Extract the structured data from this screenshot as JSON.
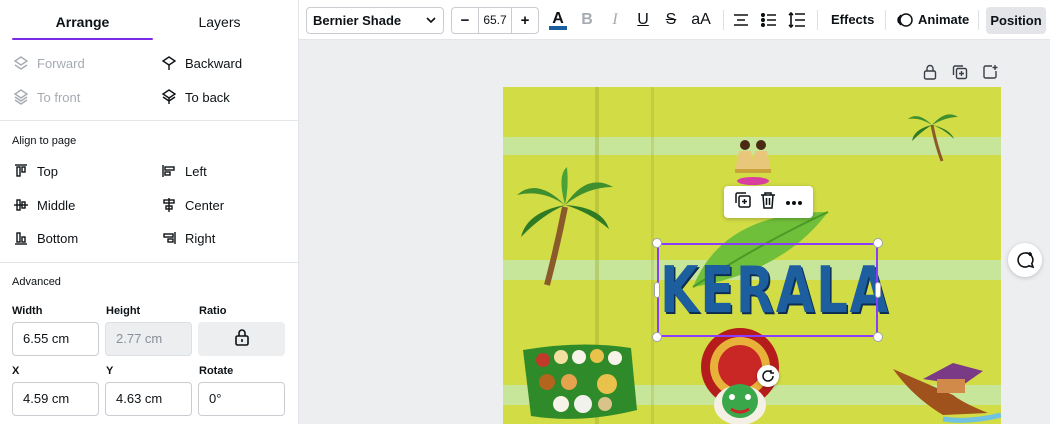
{
  "panel": {
    "tabs": {
      "arrange": "Arrange",
      "layers": "Layers"
    },
    "order": {
      "forward": "Forward",
      "backward": "Backward",
      "to_front": "To front",
      "to_back": "To back"
    },
    "align": {
      "title": "Align to page",
      "top": "Top",
      "left": "Left",
      "middle": "Middle",
      "center": "Center",
      "bottom": "Bottom",
      "right": "Right"
    },
    "advanced": {
      "title": "Advanced",
      "width_label": "Width",
      "width_value": "6.55 cm",
      "height_label": "Height",
      "height_value": "2.77 cm",
      "ratio_label": "Ratio",
      "x_label": "X",
      "x_value": "4.59 cm",
      "y_label": "Y",
      "y_value": "4.63 cm",
      "rotate_label": "Rotate",
      "rotate_value": "0°"
    }
  },
  "toolbar": {
    "font_name": "Bernier Shade",
    "font_size": "65.7",
    "decrease": "−",
    "increase": "+",
    "case_label": "aA",
    "effects": "Effects",
    "animate": "Animate",
    "position": "Position",
    "text_color": "#1d5f9e"
  },
  "canvas": {
    "text": "KERALA",
    "background_color": "#d2dc44",
    "accent": "#8b3dff"
  }
}
